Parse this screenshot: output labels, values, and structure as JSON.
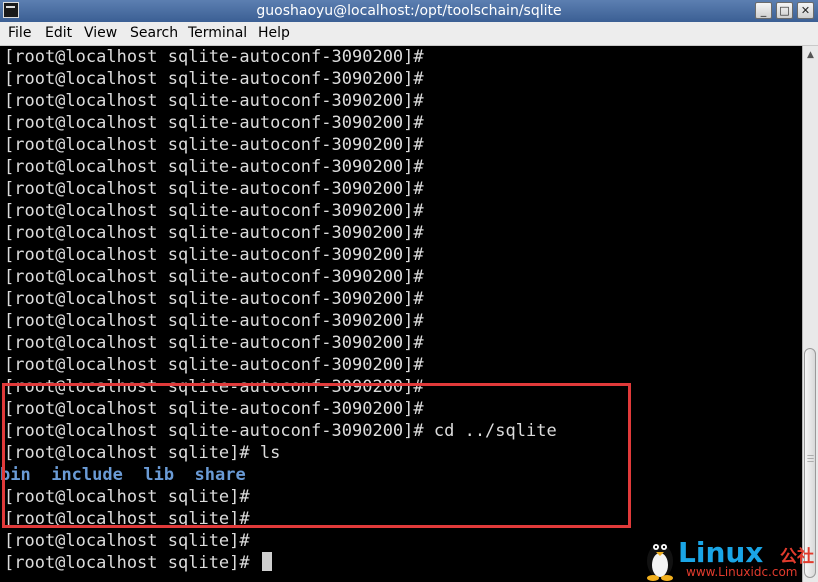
{
  "window": {
    "title": "guoshaoyu@localhost:/opt/toolschain/sqlite",
    "minimize_glyph": "_",
    "maximize_glyph": "□",
    "close_glyph": "✕"
  },
  "menu": [
    "File",
    "Edit",
    "View",
    "Search",
    "Terminal",
    "Help"
  ],
  "terminal": {
    "prompt_autoconf": "[root@localhost sqlite-autoconf-3090200]#",
    "prompt_sqlite": "[root@localhost sqlite]#",
    "cmd_cd": " cd ../sqlite",
    "cmd_ls": " ls",
    "ls_output": [
      "bin",
      "include",
      "lib",
      "share"
    ]
  },
  "watermark": {
    "brand": "Linux",
    "brand_cn": "公社",
    "url": "www.Linuxidc.com"
  },
  "colors": {
    "terminal_bg": "#000000",
    "terminal_fg": "#dcdcdc",
    "directory": "#6a9bd6",
    "highlight_box": "#e03a3a"
  }
}
